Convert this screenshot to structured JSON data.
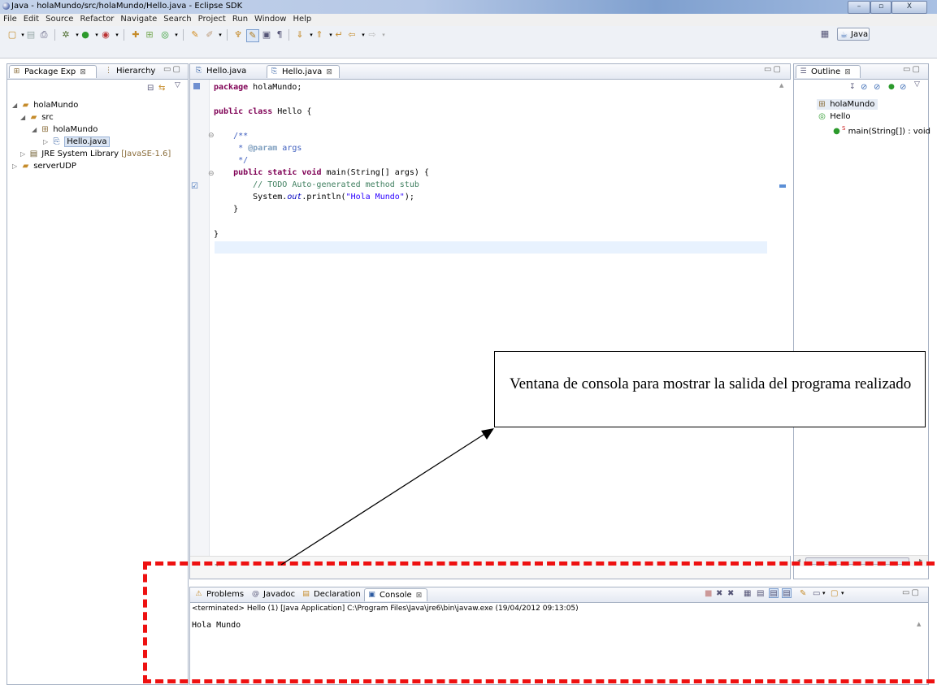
{
  "window": {
    "title": "Java - holaMundo/src/holaMundo/Hello.java - Eclipse SDK",
    "controls": [
      "–",
      "▫",
      "X"
    ]
  },
  "menu": [
    "File",
    "Edit",
    "Source",
    "Refactor",
    "Navigate",
    "Search",
    "Project",
    "Run",
    "Window",
    "Help"
  ],
  "perspective": {
    "label": "Java"
  },
  "left_panel": {
    "tabs": [
      {
        "label": "Package Exp",
        "close": "⊠"
      },
      {
        "label": "Hierarchy",
        "close": ""
      }
    ],
    "tree": [
      {
        "label": "holaMundo",
        "depth": 0,
        "twisty": "◢",
        "icon": "project"
      },
      {
        "label": "src",
        "depth": 1,
        "twisty": "◢",
        "icon": "src"
      },
      {
        "label": "holaMundo",
        "depth": 2,
        "twisty": "◢",
        "icon": "package"
      },
      {
        "label": "Hello.java",
        "depth": 3,
        "twisty": "▷",
        "icon": "java"
      },
      {
        "label": "JRE System Library",
        "suffix": "[JavaSE-1.6]",
        "depth": 1,
        "twisty": "▷",
        "icon": "library"
      },
      {
        "label": "serverUDP",
        "depth": 0,
        "twisty": "▷",
        "icon": "project"
      }
    ]
  },
  "editor": {
    "tabs": [
      {
        "label": "Hello.java",
        "close": ""
      },
      {
        "label": "Hello.java",
        "close": "⊠"
      }
    ],
    "lines": {
      "l1_kw": "package",
      "l1_rest": " holaMundo;",
      "l3_kw1": "public",
      "l3_kw2": "class",
      "l3_rest": " Hello {",
      "l5": "    /**",
      "l6_star": "     * ",
      "l6_tag": "@param",
      "l6_rest": " args",
      "l7": "     */",
      "l8_indent": "    ",
      "l8_kw1": "public",
      "l8_kw2": "static",
      "l8_kw3": "void",
      "l8_rest": " main(String[] args) {",
      "l9": "        // TODO Auto-generated method stub",
      "l10_a": "        System.",
      "l10_field": "out",
      "l10_b": ".println(",
      "l10_str": "\"Hola Mundo\"",
      "l10_c": ");",
      "l11": "    }",
      "l13": "}"
    }
  },
  "outline": {
    "tab": {
      "label": "Outline",
      "close": "⊠"
    },
    "items": [
      {
        "label": "holaMundo",
        "icon": "package"
      },
      {
        "label": "Hello",
        "icon": "class"
      },
      {
        "label": "main(String[]) : void",
        "icon": "method",
        "mark": "S"
      }
    ]
  },
  "bottom_panel": {
    "tabs": [
      {
        "label": "Problems"
      },
      {
        "label": "Javadoc"
      },
      {
        "label": "Declaration"
      },
      {
        "label": "Console",
        "close": "⊠"
      }
    ],
    "status": "<terminated> Hello (1) [Java Application] C:\\Program Files\\Java\\jre6\\bin\\javaw.exe (19/04/2012 09:13:05)",
    "output": "Hola Mundo"
  },
  "annotation": {
    "text": "Ventana de consola para mostrar la salida del programa realizado",
    "color": "#e11111"
  }
}
